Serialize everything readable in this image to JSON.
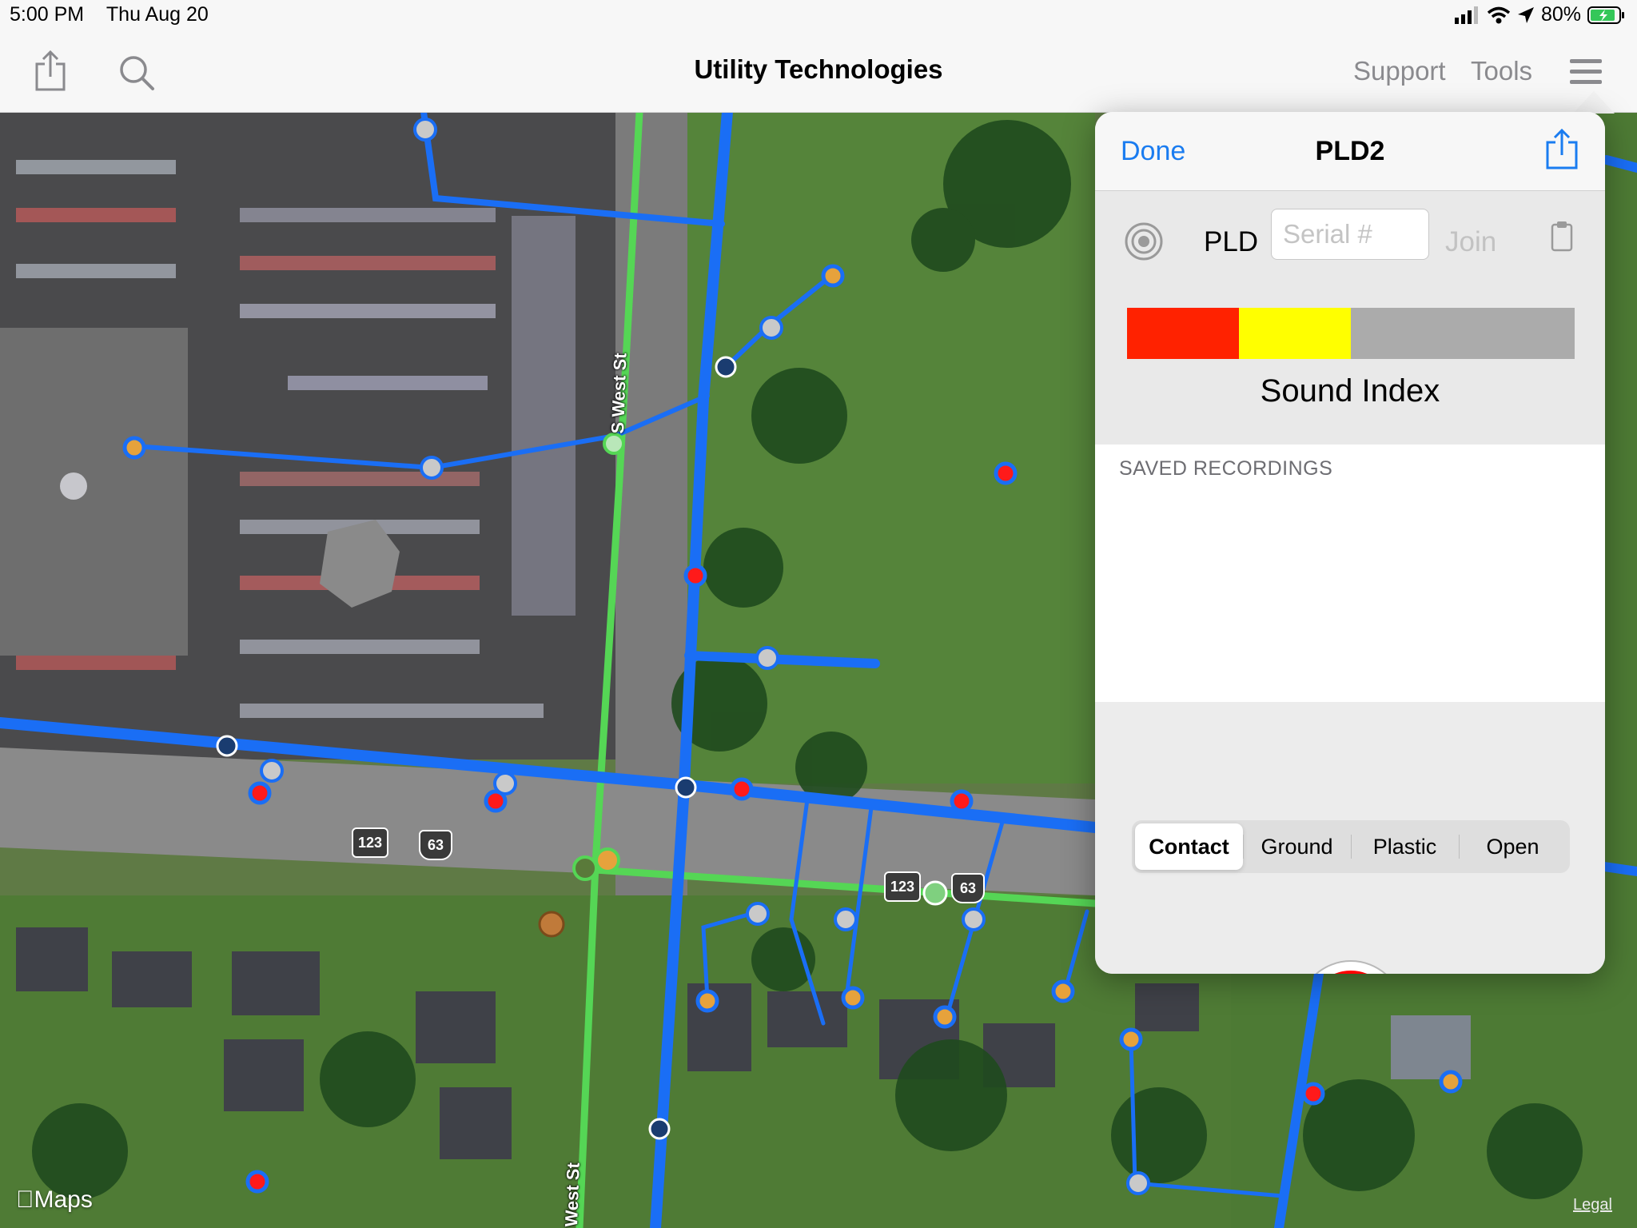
{
  "status_bar": {
    "time": "5:00 PM",
    "date": "Thu Aug 20",
    "battery": "80%"
  },
  "nav": {
    "title": "Utility Technologies",
    "support_label": "Support",
    "tools_label": "Tools",
    "icons": [
      "share-icon",
      "search-icon",
      "hamburger-menu-icon"
    ]
  },
  "panel": {
    "done_label": "Done",
    "title": "PLD2",
    "device_label": "PLD",
    "serial_placeholder": "Serial #",
    "serial_value": "",
    "join_label": "Join",
    "sound_index_label": "Sound Index",
    "sound_meter": {
      "red_fraction": 0.25,
      "yellow_fraction": 0.25,
      "colors": {
        "red": "#ff2200",
        "yellow": "#ffff00",
        "empty": "#ababab"
      }
    },
    "saved_recordings_label": "SAVED RECORDINGS",
    "saved_recordings": [],
    "modes": [
      {
        "label": "Contact",
        "selected": true
      },
      {
        "label": "Ground",
        "selected": false
      },
      {
        "label": "Plastic",
        "selected": false
      },
      {
        "label": "Open",
        "selected": false
      }
    ],
    "record_color": "#ff0000"
  },
  "map": {
    "street_labels": [
      "S West St",
      "West St"
    ],
    "route_shields": [
      "123",
      "63",
      "123",
      "63"
    ],
    "attribution": "Maps",
    "legal_label": "Legal",
    "colors": {
      "water_main": "#1a6ef5",
      "gas_main": "#55d655",
      "valve_red": "#ff1a1a",
      "meter_orange": "#e6a23c"
    }
  }
}
